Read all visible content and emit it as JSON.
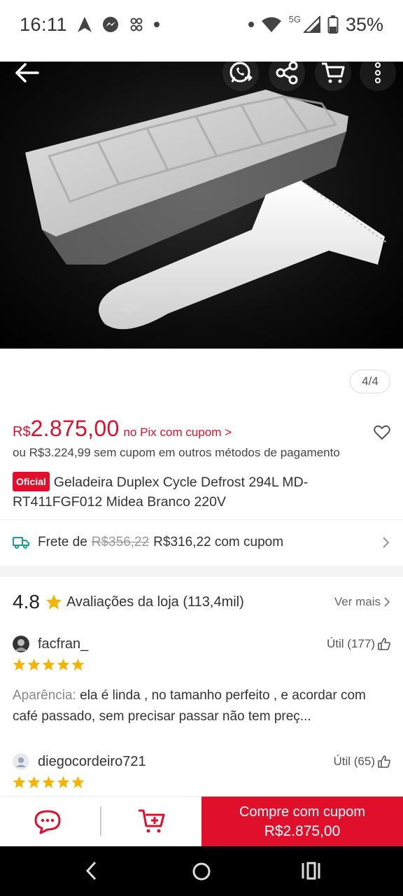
{
  "status_bar": {
    "time": "16:11",
    "network": "5G",
    "battery": "35%"
  },
  "product_image": {
    "pager": "4/4"
  },
  "price": {
    "currency": "R$",
    "value": "2.875,00",
    "pix_label": "no Pix com cupom >",
    "alt_price": "ou R$3.224,99 sem cupom em outros métodos de pagamento"
  },
  "product": {
    "badge": "Oficial",
    "title": "Geladeira Duplex Cycle Defrost 294L MD-RT411FGF012 Midea Branco 220V"
  },
  "shipping": {
    "label": "Frete de",
    "old_price": "R$356,22",
    "new_price": "R$316,22 com cupom"
  },
  "store_rating": {
    "score": "4.8",
    "label": "Avaliações da loja (113,4mil)",
    "more": "Ver mais"
  },
  "reviews": [
    {
      "user": "facfran_",
      "useful": "Útil (177)",
      "stars": 5,
      "aspect": "Aparência:",
      "text": "ela é linda , no tamanho perfeito , e acordar com café passado, sem precisar passar não tem preç..."
    },
    {
      "user": "diegocordeiro721",
      "useful": "Útil (65)",
      "stars": 5
    }
  ],
  "action_bar": {
    "buy_label": "Compre com cupom",
    "buy_price": "R$2.875,00"
  },
  "colors": {
    "accent": "#e0102c",
    "star": "#f5b400",
    "ship_icon": "#1aa08c"
  }
}
